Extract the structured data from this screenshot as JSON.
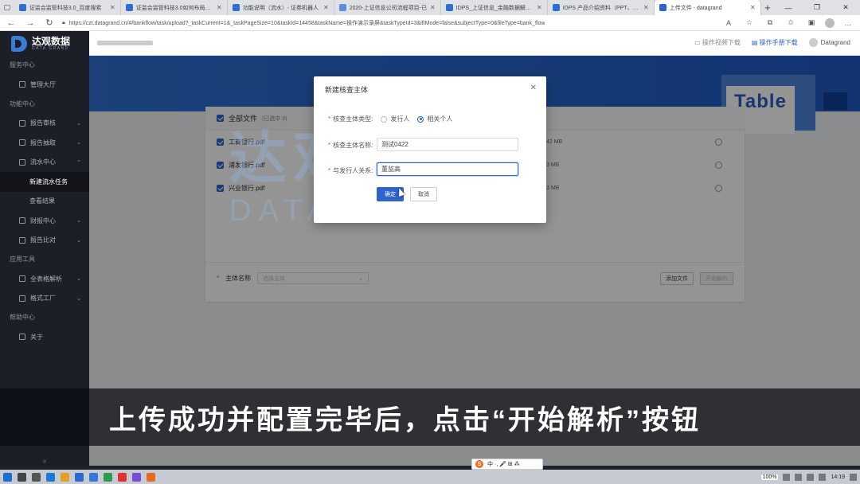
{
  "browser": {
    "tabs": [
      {
        "title": "证监会监管科技3.0_百度搜索",
        "color": "#2f6fd2"
      },
      {
        "title": "证监会监管科技3.0如何布局? 资",
        "color": "#2f6fd2"
      },
      {
        "title": "功能说明（流水）- 证券机器人",
        "color": "#2f6fd2"
      },
      {
        "title": "2020-上证信息公司流程项目-已",
        "color": "#5a8fe0"
      },
      {
        "title": "IDPS_上证信息_金融数据解析平台",
        "color": "#2f6fd2"
      },
      {
        "title": "IDPS 产品介绍资料（PPT、视频",
        "color": "#2f6fd2"
      },
      {
        "title": "上传文件 - datagrand",
        "color": "#2e64c9",
        "active": true
      }
    ],
    "url": "https://czt.datagrand.cn/#/bankflow/task/upload?_taskCurrent=1&_taskPageSize=10&taskId=14458&taskName=操作演示录屏&taskTypeId=3&ifIMode=false&subjectType=0&fileType=bank_flow"
  },
  "header": {
    "brand_cn": "达观数据",
    "brand_en": "DATA GRAND",
    "video_link": "操作视频下载",
    "manual_link": "操作手册下载",
    "user": "Datagrand"
  },
  "sidebar": {
    "groups": [
      {
        "title": "服务中心",
        "items": [
          {
            "label": "管理大厅",
            "icon": "home-icon"
          }
        ]
      },
      {
        "title": "功能中心",
        "items": [
          {
            "label": "报告审核",
            "icon": "audit-icon",
            "arrow": "⌄"
          },
          {
            "label": "报告抽取",
            "icon": "extract-icon",
            "arrow": "⌄"
          },
          {
            "label": "流水中心",
            "icon": "flow-icon",
            "arrow": "⌃",
            "subs": [
              "新建流水任务",
              "查看结果"
            ],
            "active_sub": 0
          },
          {
            "label": "财报中心",
            "icon": "finance-icon",
            "arrow": "⌄"
          },
          {
            "label": "报告比对",
            "icon": "compare-icon",
            "arrow": "⌄"
          }
        ]
      },
      {
        "title": "应用工具",
        "items": [
          {
            "label": "全表格解析",
            "icon": "table-icon",
            "arrow": "⌄"
          },
          {
            "label": "格式工厂",
            "icon": "format-icon",
            "arrow": "⌄"
          }
        ]
      },
      {
        "title": "帮助中心",
        "items": [
          {
            "label": "关于",
            "icon": "info-icon"
          }
        ]
      }
    ],
    "collapse": "«"
  },
  "banner": {
    "text": "Table"
  },
  "upload_panel": {
    "all_files": "全部文件",
    "all_files_meta": "(已选中 3)",
    "files": [
      {
        "name": "工商银行.pdf",
        "size": "42 MB"
      },
      {
        "name": "浦发银行.pdf",
        "size": "3 MB"
      },
      {
        "name": "兴业银行.pdf",
        "size": "3 MB"
      }
    ],
    "subject_label": "主体名称",
    "subject_placeholder": "选择主体",
    "add_file": "添加文件",
    "start_parse": "开始解析"
  },
  "watermark": {
    "cn": "达观数据",
    "en": "DATA GRAND"
  },
  "dialog": {
    "title": "新建核查主体",
    "type_label": "核查主体类型:",
    "type_options": [
      "发行人",
      "相关个人"
    ],
    "type_selected": 1,
    "name_label": "核查主体名称:",
    "name_value": "测试0422",
    "relation_label": "与发行人关系:",
    "relation_value": "董监高",
    "ok": "确定",
    "cancel": "取消"
  },
  "subtitle": "上传成功并配置完毕后，点击“开始解析”按钮",
  "ime": {
    "label": "中 ·, 🎤 ⊞ ⁂"
  },
  "taskbar": {
    "battery": "100%",
    "time": "14:19"
  }
}
